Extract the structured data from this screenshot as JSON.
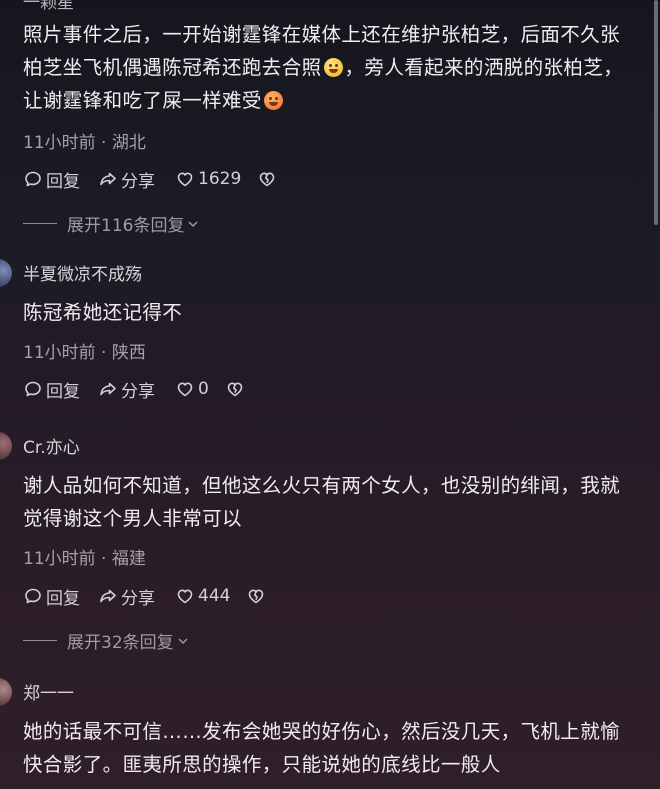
{
  "comments": [
    {
      "username": "一颗星",
      "text_parts": [
        "照片事件之后，一开始谢霆锋在媒体上还在维护张柏芝，后面不久张柏芝坐飞机偶遇陈冠希还跑去合照",
        "，旁人看起来的洒脱的张柏芝，让谢霆锋和吃了屎一样难受"
      ],
      "emoji_names": [
        "laughing-emoji",
        "tongue-emoji"
      ],
      "time": "11小时前",
      "location": "湖北",
      "reply_label": "回复",
      "share_label": "分享",
      "likes": "1629",
      "expand_label": "展开116条回复"
    },
    {
      "username": "半夏微凉不成殇",
      "text": "陈冠希她还记得不",
      "time": "11小时前",
      "location": "陕西",
      "reply_label": "回复",
      "share_label": "分享",
      "likes": "0"
    },
    {
      "username": "Cr.亦心",
      "text": "谢人品如何不知道，但他这么火只有两个女人，也没别的绯闻，我就觉得谢这个男人非常可以",
      "time": "11小时前",
      "location": "福建",
      "reply_label": "回复",
      "share_label": "分享",
      "likes": "444",
      "expand_label": "展开32条回复"
    },
    {
      "username": "郑一一",
      "text": "她的话最不可信……发布会她哭的好伤心，然后没几天，飞机上就愉快合影了。匪夷所思的操作，只能说她的底线比一般人"
    }
  ],
  "separator": "·",
  "icons": {
    "reply": "chat-bubble-icon",
    "share": "share-arrow-icon",
    "like": "heart-icon",
    "dislike": "broken-heart-icon",
    "expand": "chevron-down-icon"
  }
}
